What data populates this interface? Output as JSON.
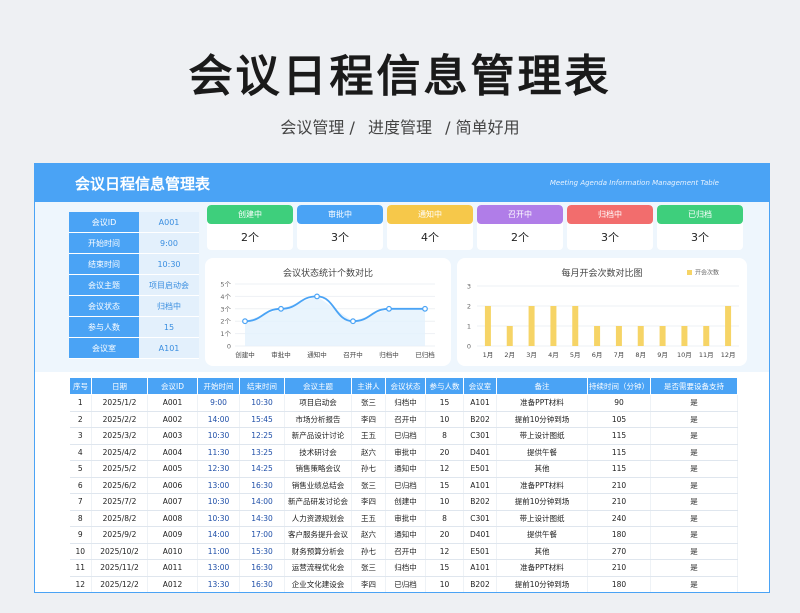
{
  "page": {
    "title": "会议日程信息管理表",
    "subtitle": [
      "会议管理 /",
      "进度管理",
      "/ 简单好用"
    ]
  },
  "sheet": {
    "title": "会议日程信息管理表",
    "title_en": "Meeting Agenda Information Management Table"
  },
  "info": [
    {
      "label": "会议ID",
      "value": "A001"
    },
    {
      "label": "开始时间",
      "value": "9:00"
    },
    {
      "label": "结束时间",
      "value": "10:30"
    },
    {
      "label": "会议主题",
      "value": "项目启动会"
    },
    {
      "label": "会议状态",
      "value": "归档中"
    },
    {
      "label": "参与人数",
      "value": "15"
    },
    {
      "label": "会议室",
      "value": "A101"
    }
  ],
  "cards": [
    {
      "label": "创建中",
      "count": "2个",
      "color": "#3ecf7c"
    },
    {
      "label": "审批中",
      "count": "3个",
      "color": "#4aa3f5"
    },
    {
      "label": "通知中",
      "count": "4个",
      "color": "#f6c84a"
    },
    {
      "label": "召开中",
      "count": "2个",
      "color": "#b07de8"
    },
    {
      "label": "归档中",
      "count": "3个",
      "color": "#f26d6d"
    },
    {
      "label": "已归档",
      "count": "3个",
      "color": "#3ecf7c"
    }
  ],
  "chart_data": [
    {
      "type": "line",
      "title": "会议状态统计个数对比",
      "categories": [
        "创建中",
        "审批中",
        "通知中",
        "召开中",
        "归档中",
        "已归档"
      ],
      "values": [
        2,
        3,
        4,
        2,
        3,
        3
      ],
      "ylim": [
        0,
        5
      ],
      "yticks": [
        "0",
        "1个",
        "2个",
        "3个",
        "4个",
        "5个"
      ],
      "color": "#4aa3f5"
    },
    {
      "type": "bar",
      "title": "每月开会次数对比图",
      "legend": "开会次数",
      "categories": [
        "1月",
        "2月",
        "3月",
        "4月",
        "5月",
        "6月",
        "7月",
        "8月",
        "9月",
        "10月",
        "11月",
        "12月"
      ],
      "values": [
        2,
        1,
        2,
        2,
        2,
        1,
        1,
        1,
        1,
        1,
        1,
        2
      ],
      "ylim": [
        0,
        3
      ],
      "yticks": [
        "0",
        "1",
        "2",
        "3"
      ],
      "color": "#f6d466"
    }
  ],
  "table": {
    "headers": [
      "序号",
      "日期",
      "会议ID",
      "开始时间",
      "结束时间",
      "会议主题",
      "主讲人",
      "会议状态",
      "参与人数",
      "会议室",
      "备注",
      "持续时间（分钟）",
      "是否需要设备支持"
    ],
    "rows": [
      [
        "1",
        "2025/1/2",
        "A001",
        "9:00",
        "10:30",
        "项目启动会",
        "张三",
        "归档中",
        "15",
        "A101",
        "准备PPT材料",
        "90",
        "是"
      ],
      [
        "2",
        "2025/2/2",
        "A002",
        "14:00",
        "15:45",
        "市场分析报告",
        "李四",
        "召开中",
        "10",
        "B202",
        "提前10分钟到场",
        "105",
        "是"
      ],
      [
        "3",
        "2025/3/2",
        "A003",
        "10:30",
        "12:25",
        "新产品设计讨论",
        "王五",
        "已归档",
        "8",
        "C301",
        "带上设计图纸",
        "115",
        "是"
      ],
      [
        "4",
        "2025/4/2",
        "A004",
        "11:30",
        "13:25",
        "技术研讨会",
        "赵六",
        "审批中",
        "20",
        "D401",
        "提供午餐",
        "115",
        "是"
      ],
      [
        "5",
        "2025/5/2",
        "A005",
        "12:30",
        "14:25",
        "销售策略会议",
        "孙七",
        "通知中",
        "12",
        "E501",
        "其他",
        "115",
        "是"
      ],
      [
        "6",
        "2025/6/2",
        "A006",
        "13:00",
        "16:30",
        "销售业绩总结会",
        "张三",
        "已归档",
        "15",
        "A101",
        "准备PPT材料",
        "210",
        "是"
      ],
      [
        "7",
        "2025/7/2",
        "A007",
        "10:30",
        "14:00",
        "新产品研发讨论会",
        "李四",
        "创建中",
        "10",
        "B202",
        "提前10分钟到场",
        "210",
        "是"
      ],
      [
        "8",
        "2025/8/2",
        "A008",
        "10:30",
        "14:30",
        "人力资源规划会",
        "王五",
        "审批中",
        "8",
        "C301",
        "带上设计图纸",
        "240",
        "是"
      ],
      [
        "9",
        "2025/9/2",
        "A009",
        "14:00",
        "17:00",
        "客户服务提升会议",
        "赵六",
        "通知中",
        "20",
        "D401",
        "提供午餐",
        "180",
        "是"
      ],
      [
        "10",
        "2025/10/2",
        "A010",
        "11:00",
        "15:30",
        "财务预算分析会",
        "孙七",
        "召开中",
        "12",
        "E501",
        "其他",
        "270",
        "是"
      ],
      [
        "11",
        "2025/11/2",
        "A011",
        "13:00",
        "16:30",
        "运营流程优化会",
        "张三",
        "归档中",
        "15",
        "A101",
        "准备PPT材料",
        "210",
        "是"
      ],
      [
        "12",
        "2025/12/2",
        "A012",
        "13:30",
        "16:30",
        "企业文化建设会",
        "李四",
        "已归档",
        "10",
        "B202",
        "提前10分钟到场",
        "180",
        "是"
      ]
    ]
  }
}
